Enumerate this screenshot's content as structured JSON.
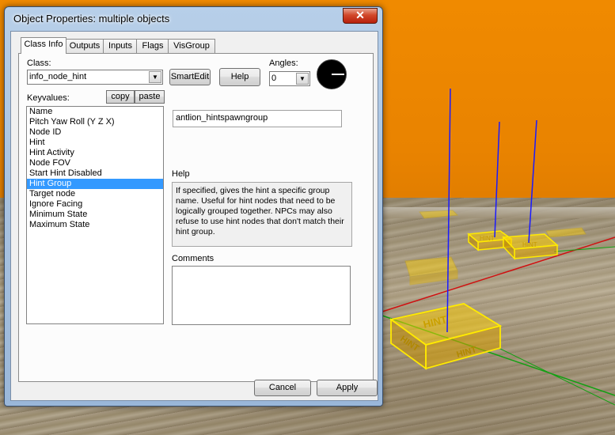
{
  "window": {
    "title": "Object Properties: multiple objects",
    "close_glyph": "✕"
  },
  "tabs": [
    {
      "label": "Class Info",
      "active": true
    },
    {
      "label": "Outputs",
      "active": false
    },
    {
      "label": "Inputs",
      "active": false
    },
    {
      "label": "Flags",
      "active": false
    },
    {
      "label": "VisGroup",
      "active": false
    }
  ],
  "class_section": {
    "class_label": "Class:",
    "class_value": "info_node_hint",
    "smartedit_label": "SmartEdit",
    "help_label": "Help",
    "angles_label": "Angles:",
    "angles_value": "0"
  },
  "keyvalues": {
    "label": "Keyvalues:",
    "copy_label": "copy",
    "paste_label": "paste",
    "items": [
      "Name",
      "Pitch Yaw Roll (Y Z X)",
      "Node ID",
      "Hint",
      "Hint Activity",
      "Node FOV",
      "Start Hint Disabled",
      "Hint Group",
      "Target node",
      "Ignore Facing",
      "Minimum State",
      "Maximum State"
    ],
    "selected_index": 7,
    "value": "antlion_hintspawngroup"
  },
  "help_panel": {
    "label": "Help",
    "text": "If specified, gives the hint a specific group name.  Useful for hint nodes that need to be logically grouped together. NPCs may also refuse to use hint nodes that don't match their hint group."
  },
  "comments": {
    "label": "Comments",
    "value": ""
  },
  "footer": {
    "cancel_label": "Cancel",
    "apply_label": "Apply"
  },
  "scene": {
    "hint_box_text": "HINT",
    "colors": {
      "wall": "#f08a00",
      "hint_box": "#ffd000",
      "axis_line": "#1a1aff"
    }
  }
}
